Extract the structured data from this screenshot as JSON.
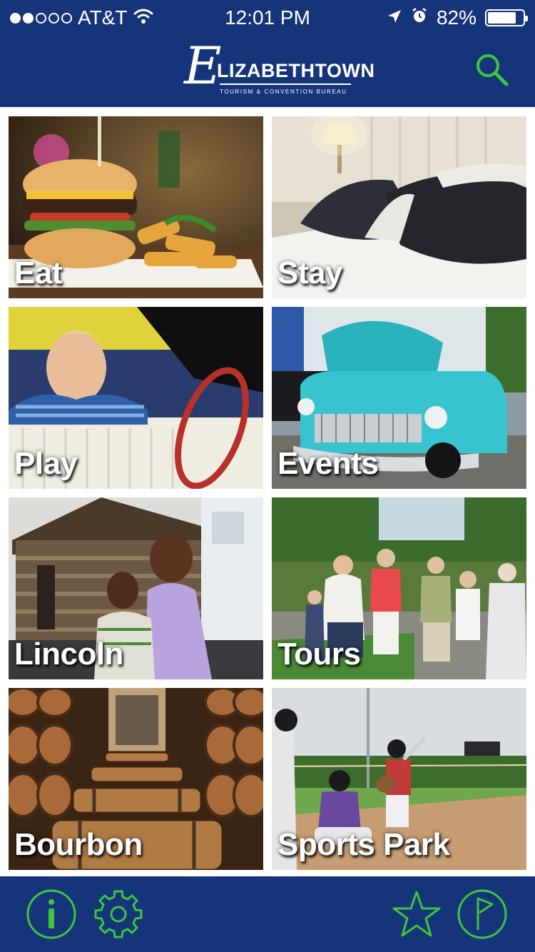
{
  "status_bar": {
    "carrier": "AT&T",
    "signal_bars_filled": 2,
    "signal_bars_total": 5,
    "time": "12:01 PM",
    "battery": "82%",
    "battery_level": 0.82
  },
  "header": {
    "logo_initial": "E",
    "logo_name": "LIZABETHTOWN",
    "logo_subtitle": "TOURISM & CONVENTION BUREAU",
    "search_icon": "search-icon"
  },
  "tiles": [
    {
      "label": "Eat"
    },
    {
      "label": "Stay"
    },
    {
      "label": "Play"
    },
    {
      "label": "Events"
    },
    {
      "label": "Lincoln"
    },
    {
      "label": "Tours"
    },
    {
      "label": "Bourbon"
    },
    {
      "label": "Sports Park"
    }
  ],
  "bottom_bar": {
    "icons": [
      "info-icon",
      "gear-icon",
      "star-icon",
      "flag-icon"
    ]
  },
  "colors": {
    "brand_navy": "#163479",
    "accent_green": "#3cc63c"
  }
}
